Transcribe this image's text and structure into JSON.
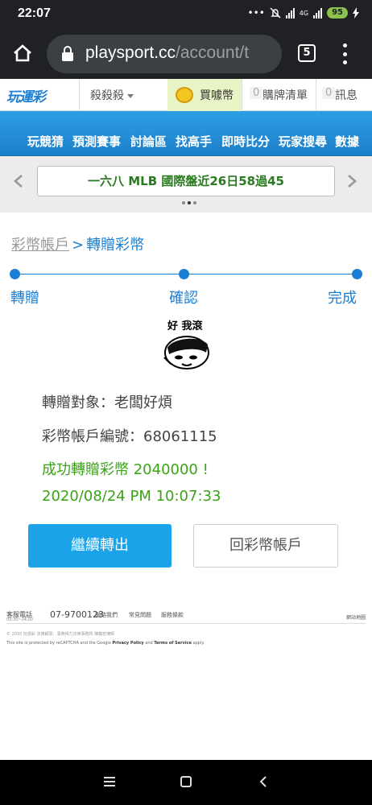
{
  "status_bar": {
    "time": "22:07",
    "network": "4G",
    "battery": "95"
  },
  "browser": {
    "url_host": "playsport.cc",
    "url_path": "/account/t",
    "tab_count": "5"
  },
  "site_header": {
    "logo_text": "玩運彩",
    "user_name": "殺殺殺",
    "buy_coin_label": "買噱幣",
    "cart_count": "0",
    "cart_label": "購牌清單",
    "msg_count": "0",
    "msg_label": "訊息"
  },
  "nav": {
    "items": [
      "玩競猜",
      "預測賽事",
      "討論區",
      "找高手",
      "即時比分",
      "玩家搜尋",
      "數據"
    ]
  },
  "ticker": {
    "text": "一六八 MLB 國際盤近26日58過45"
  },
  "breadcrumb": {
    "parent": "彩幣帳戶",
    "separator": ">",
    "current": "轉贈彩幣"
  },
  "steps": [
    "轉贈",
    "確認",
    "完成"
  ],
  "sticker": {
    "text": "好 我滾"
  },
  "details": {
    "recipient": "轉贈對象：老闆好煩",
    "account_no": "彩幣帳戶編號：68061115",
    "success_msg": "成功轉贈彩幣 2040000 !",
    "datetime": "2020/08/24 PM 10:07:33"
  },
  "buttons": {
    "continue": "繼續轉出",
    "back_to_account": "回彩幣帳戶"
  },
  "footer": {
    "phone_label": "客服電話",
    "phone_hours": "09:30~24:00",
    "phone": "07-9700123",
    "links": [
      "聯絡我們",
      "常見問題",
      "服務條款"
    ],
    "right_link": "網站地圖",
    "copyright": "© 2020 玩運彩 法律顧問：漢英得力法律事務所 陳鐵宏律師",
    "recaptcha_prefix": "This site is protected by reCAPTCHA and the Google",
    "privacy": "Privacy Policy",
    "and": "and",
    "terms": "Terms of Service",
    "apply": "apply."
  },
  "colors": {
    "brand_blue": "#1a7fd4",
    "success_green": "#3aa315",
    "button_blue": "#1aa3e8"
  }
}
